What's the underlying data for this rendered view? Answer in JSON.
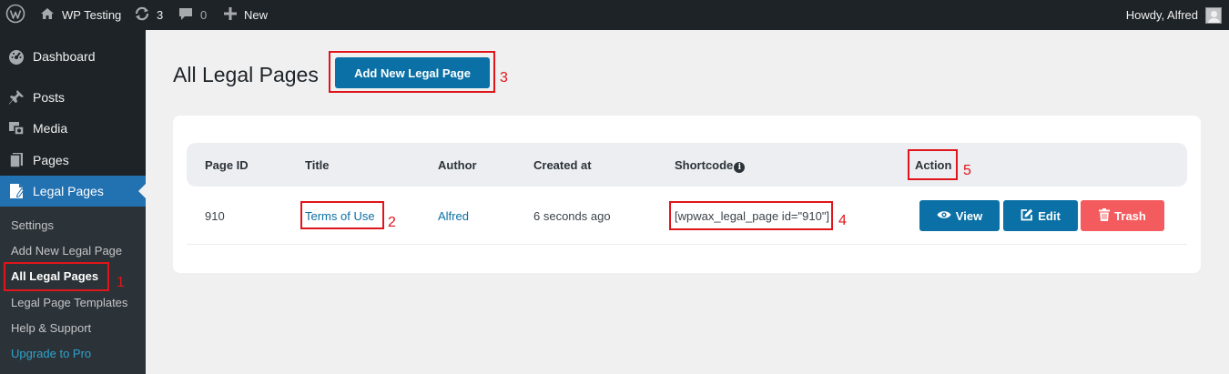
{
  "adminbar": {
    "wp_logo_icon": "wordpress-icon",
    "site_name": "WP Testing",
    "updates_count": "3",
    "comments_count": "0",
    "new_label": "New",
    "howdy": "Howdy, Alfred"
  },
  "sidebar": {
    "items": [
      {
        "label": "Dashboard",
        "icon": "dashboard-icon"
      },
      {
        "label": "Posts",
        "icon": "pin-icon"
      },
      {
        "label": "Media",
        "icon": "media-icon"
      },
      {
        "label": "Pages",
        "icon": "pages-icon"
      },
      {
        "label": "Legal Pages",
        "icon": "document-icon",
        "active": true
      }
    ],
    "submenu": [
      {
        "label": "Settings"
      },
      {
        "label": "Add New Legal Page"
      },
      {
        "label": "All Legal Pages",
        "current": true
      },
      {
        "label": "Legal Page Templates"
      },
      {
        "label": "Help & Support"
      },
      {
        "label": "Upgrade to Pro"
      }
    ]
  },
  "main": {
    "title": "All Legal Pages",
    "add_new_button": "Add New Legal Page",
    "table": {
      "headers": [
        "Page ID",
        "Title",
        "Author",
        "Created at",
        "Shortcode",
        "Action"
      ],
      "rows": [
        {
          "page_id": "910",
          "title": "Terms of Use",
          "author": "Alfred",
          "created_at": "6 seconds ago",
          "shortcode": "[wpwax_legal_page id=\"910\"]"
        }
      ],
      "actions": {
        "view": "View",
        "edit": "Edit",
        "trash": "Trash"
      }
    }
  },
  "annotations": [
    "1",
    "2",
    "3",
    "4",
    "5"
  ],
  "colors": {
    "admin_dark": "#1d2327",
    "wp_blue": "#2271b1",
    "button_blue": "#0a70a5",
    "trash_red": "#f45b5e",
    "annotation_red": "#e0151b"
  }
}
